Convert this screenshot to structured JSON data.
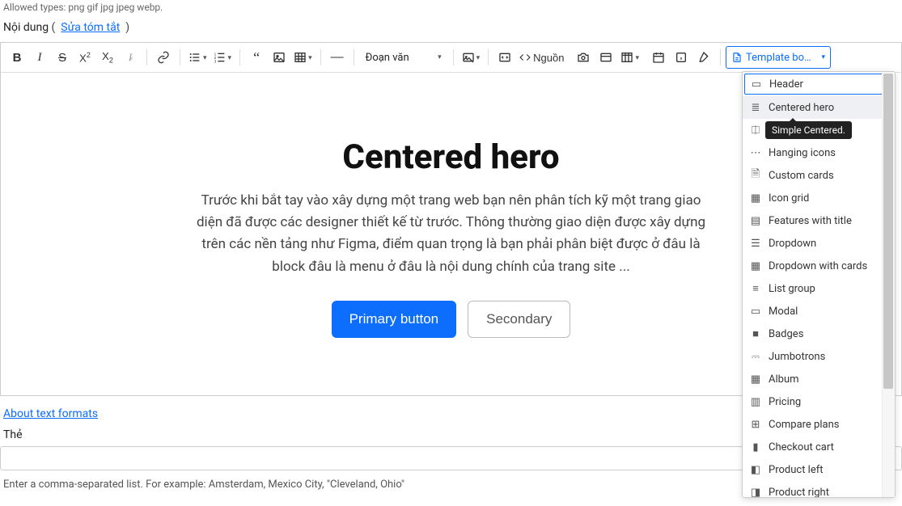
{
  "top_hint": "Allowed types: png gif jpg jpeg webp.",
  "content_label": "Nội dung",
  "edit_summary": "Sửa tóm tắt",
  "paragraph_selector": "Đoạn văn",
  "source_label": "Nguồn",
  "template_button_label": "Template bo…",
  "hero": {
    "title": "Centered hero",
    "body": "Trước khi bắt tay vào xây dựng một trang web bạn nên phân tích kỹ một trang giao diện đã được các designer thiết kế từ trước. Thông thường giao diện được xây dựng trên các nền tảng như Figma, điểm quan trọng là bạn phải phân biệt được ở đâu là block đâu là menu ở đâu là nội dung chính của trang site ...",
    "primary_btn": "Primary button",
    "secondary_btn": "Secondary"
  },
  "dropdown": {
    "tooltip": "Simple Centered.",
    "items": [
      {
        "label": "Header",
        "icon": "▭",
        "selected": true,
        "hover": false,
        "tooltip": false
      },
      {
        "label": "Centered hero",
        "icon": "≣",
        "selected": false,
        "hover": true,
        "tooltip": false
      },
      {
        "label": "",
        "icon": "⎅",
        "selected": false,
        "hover": false,
        "tooltip": true
      },
      {
        "label": "Hanging icons",
        "icon": "⋯",
        "selected": false,
        "hover": false,
        "tooltip": false
      },
      {
        "label": "Custom cards",
        "icon": "🗎",
        "selected": false,
        "hover": false,
        "tooltip": false
      },
      {
        "label": "Icon grid",
        "icon": "▦",
        "selected": false,
        "hover": false,
        "tooltip": false
      },
      {
        "label": "Features with title",
        "icon": "▤",
        "selected": false,
        "hover": false,
        "tooltip": false
      },
      {
        "label": "Dropdown",
        "icon": "☰",
        "selected": false,
        "hover": false,
        "tooltip": false
      },
      {
        "label": "Dropdown with cards",
        "icon": "▦",
        "selected": false,
        "hover": false,
        "tooltip": false
      },
      {
        "label": "List group",
        "icon": "≡",
        "selected": false,
        "hover": false,
        "tooltip": false
      },
      {
        "label": "Modal",
        "icon": "▭",
        "selected": false,
        "hover": false,
        "tooltip": false
      },
      {
        "label": "Badges",
        "icon": "■",
        "selected": false,
        "hover": false,
        "tooltip": false
      },
      {
        "label": "Jumbotrons",
        "icon": "⎓",
        "selected": false,
        "hover": false,
        "tooltip": false
      },
      {
        "label": "Album",
        "icon": "▦",
        "selected": false,
        "hover": false,
        "tooltip": false
      },
      {
        "label": "Pricing",
        "icon": "▥",
        "selected": false,
        "hover": false,
        "tooltip": false
      },
      {
        "label": "Compare plans",
        "icon": "⊞",
        "selected": false,
        "hover": false,
        "tooltip": false
      },
      {
        "label": "Checkout cart",
        "icon": "▮",
        "selected": false,
        "hover": false,
        "tooltip": false
      },
      {
        "label": "Product left",
        "icon": "◧",
        "selected": false,
        "hover": false,
        "tooltip": false
      },
      {
        "label": "Product right",
        "icon": "◨",
        "selected": false,
        "hover": false,
        "tooltip": false
      }
    ]
  },
  "about_link": "About text formats",
  "the_label": "Thẻ",
  "helper_text": "Enter a comma-separated list. For example: Amsterdam, Mexico City, \"Cleveland, Ohio\""
}
